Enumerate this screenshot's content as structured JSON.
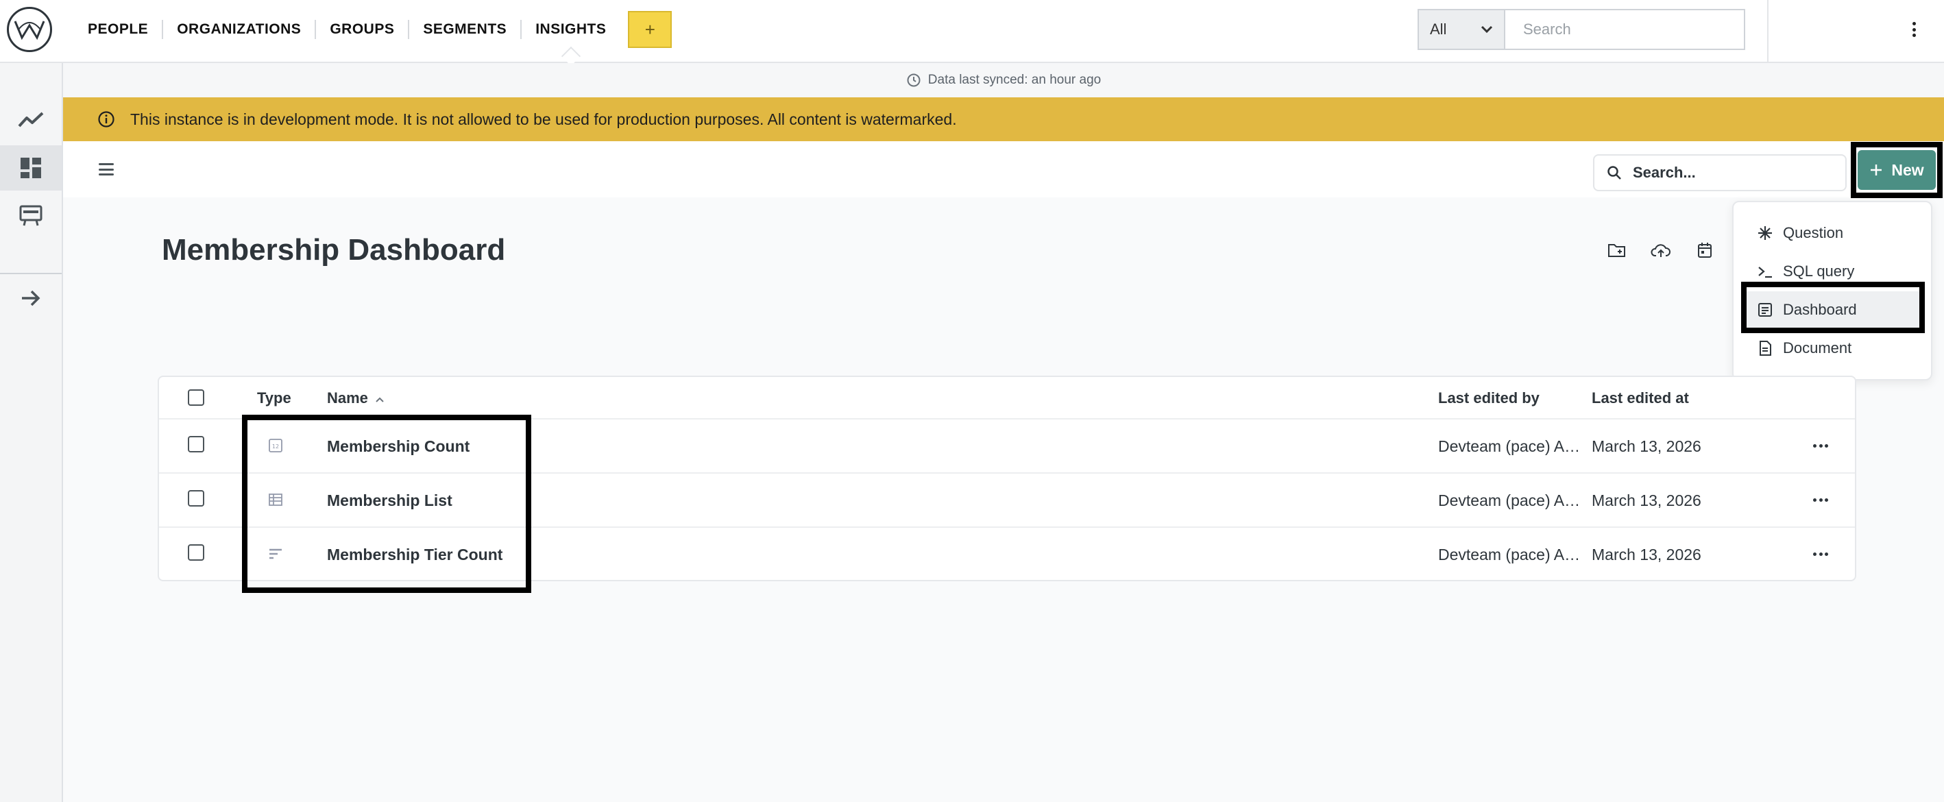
{
  "topnav": {
    "items": [
      {
        "label": "PEOPLE"
      },
      {
        "label": "ORGANIZATIONS"
      },
      {
        "label": "GROUPS"
      },
      {
        "label": "SEGMENTS"
      },
      {
        "label": "INSIGHTS",
        "active": true
      }
    ],
    "plus_label": "+",
    "scope_value": "All",
    "search_placeholder": "Search"
  },
  "sync": {
    "text": "Data last synced: an hour ago"
  },
  "banner": {
    "text": "This instance is in development mode. It is not allowed to be used for production purposes. All content is watermarked.",
    "color": "#e1b842"
  },
  "content": {
    "search_placeholder": "Search...",
    "new_button": "New",
    "accent_color": "#4b8f84"
  },
  "menu": {
    "items": [
      {
        "label": "Question",
        "icon": "question-asterisk-icon"
      },
      {
        "label": "SQL query",
        "icon": "sql-terminal-icon"
      },
      {
        "label": "Dashboard",
        "icon": "dashboard-icon",
        "selected": true
      },
      {
        "label": "Document",
        "icon": "document-icon"
      }
    ]
  },
  "page": {
    "title": "Membership Dashboard"
  },
  "table": {
    "headers": {
      "type": "Type",
      "name": "Name",
      "edited_by": "Last edited by",
      "edited_at": "Last edited at"
    },
    "sort": {
      "column": "Name",
      "direction": "ascending"
    },
    "rows": [
      {
        "type": "number-card-icon",
        "name": "Membership Count",
        "edited_by": "Devteam (pace) Admin",
        "edited_at": "March 13, 2026"
      },
      {
        "type": "table-grid-icon",
        "name": "Membership List",
        "edited_by": "Devteam (pace) Admin",
        "edited_at": "March 13, 2026"
      },
      {
        "type": "bar-list-icon",
        "name": "Membership Tier Count",
        "edited_by": "Devteam (pace) Admin",
        "edited_at": "March 13, 2026"
      }
    ]
  }
}
